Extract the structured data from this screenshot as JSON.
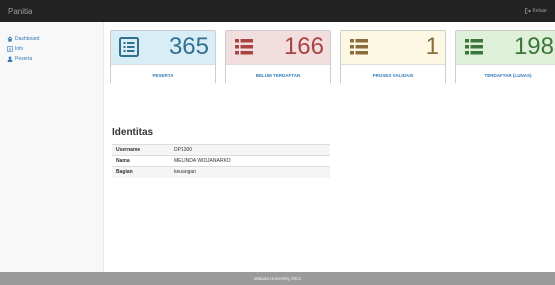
{
  "app": {
    "title": "Panitia",
    "logout_label": "Keluar"
  },
  "sidebar": {
    "items": [
      {
        "label": "Dashboard",
        "icon": "home-icon"
      },
      {
        "label": "Info",
        "icon": "info-icon"
      },
      {
        "label": "Peserta",
        "icon": "user-icon"
      }
    ]
  },
  "cards": [
    {
      "value": "365",
      "label": "PESERTA",
      "icon": "list-alt-icon",
      "color": "#31708f",
      "bg": "#d9edf7"
    },
    {
      "value": "166",
      "label": "BELUM TERDAFTAR",
      "icon": "list-icon",
      "color": "#a94442",
      "bg": "#f2dede"
    },
    {
      "value": "1",
      "label": "PROSES VALIDASI",
      "icon": "list-icon",
      "color": "#8a6d3b",
      "bg": "#fcf8e3"
    },
    {
      "value": "198",
      "label": "TERDAFTAR (LUNAS)",
      "icon": "list-icon",
      "color": "#3c763d",
      "bg": "#dff0d8"
    }
  ],
  "identitas": {
    "title": "Identitas",
    "rows": [
      {
        "key": "Username",
        "value": "DP1300"
      },
      {
        "key": "Nama",
        "value": "MELINDA WIDJANARKO"
      },
      {
        "key": "Bagian",
        "value": "keuangan"
      }
    ]
  },
  "footer": {
    "text": "Matana University 2021"
  }
}
